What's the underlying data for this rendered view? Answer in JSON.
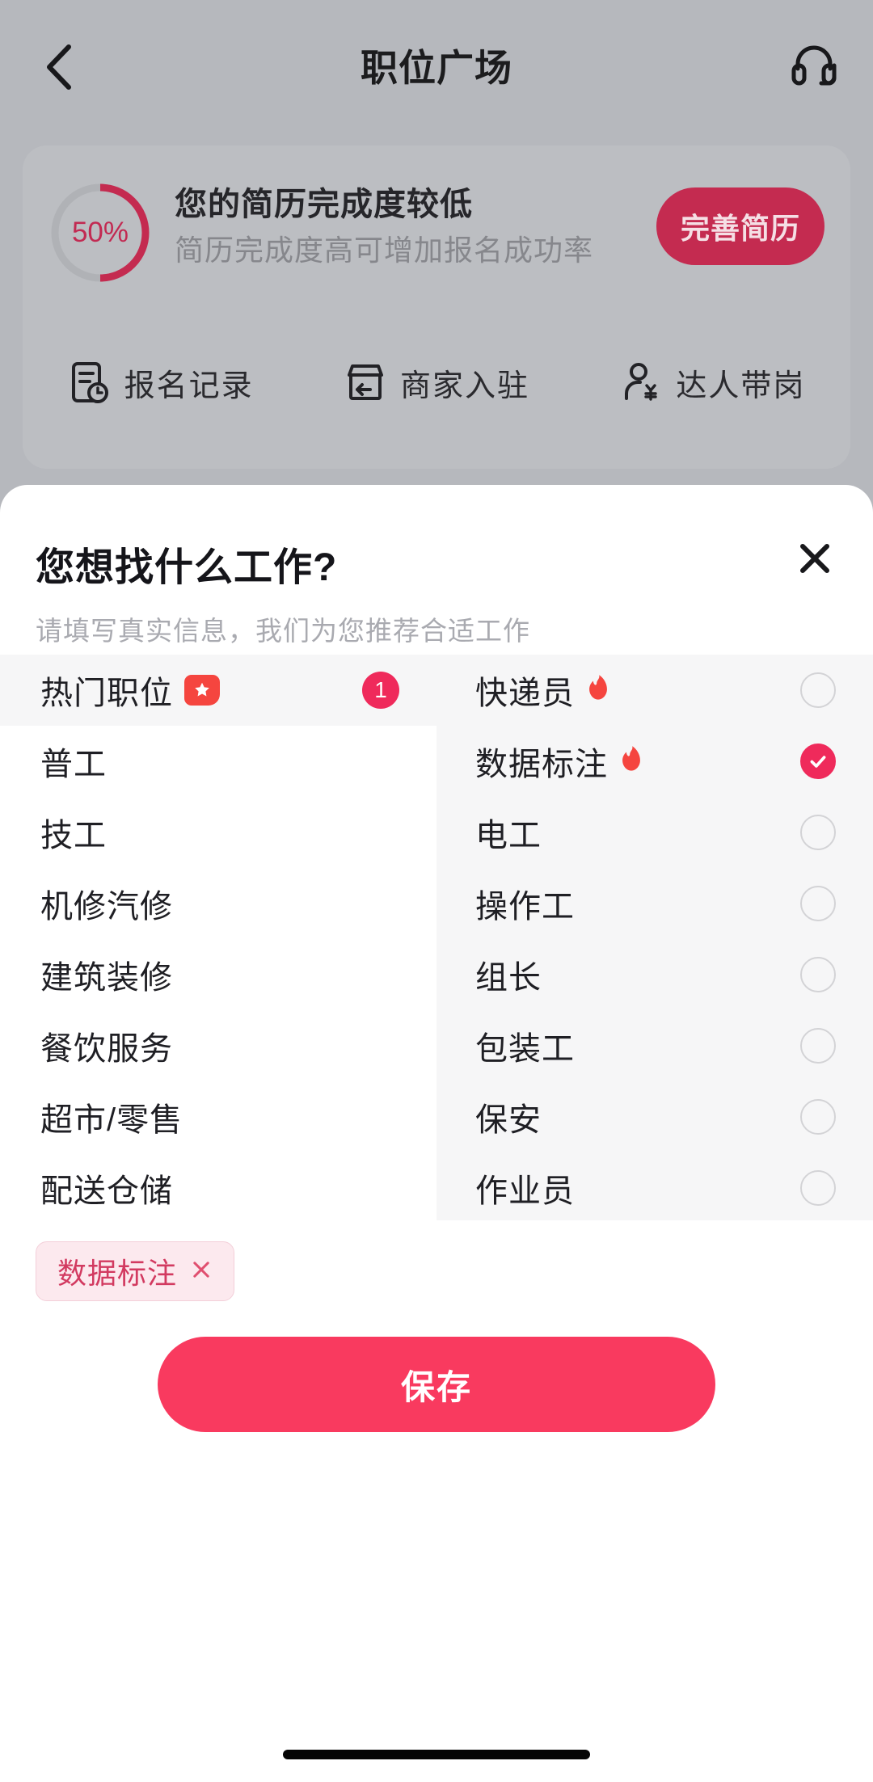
{
  "nav": {
    "back_icon": "chevron-left-icon",
    "title": "职位广场",
    "service_icon": "headset-icon"
  },
  "resume_card": {
    "progress_value": "50%",
    "progress_percent": 50,
    "title": "您的简历完成度较低",
    "subtitle": "简历完成度高可增加报名成功率",
    "button_label": "完善简历",
    "accent_color": "#c42b50",
    "shortcuts": [
      {
        "label": "报名记录",
        "icon": "document-clock-icon"
      },
      {
        "label": "商家入驻",
        "icon": "shop-enter-icon"
      },
      {
        "label": "达人带岗",
        "icon": "person-yuan-icon"
      }
    ]
  },
  "sheet": {
    "title": "您想找什么工作?",
    "subtitle": "请填写真实信息，我们为您推荐合适工作",
    "close_icon": "close-icon",
    "categories": [
      {
        "label": "热门职位",
        "active": true,
        "tag_icon": "star-tag-icon",
        "badge": "1"
      },
      {
        "label": "普工",
        "active": false
      },
      {
        "label": "技工",
        "active": false
      },
      {
        "label": "机修汽修",
        "active": false
      },
      {
        "label": "建筑装修",
        "active": false
      },
      {
        "label": "餐饮服务",
        "active": false
      },
      {
        "label": "超市/零售",
        "active": false
      },
      {
        "label": "配送仓储",
        "active": false
      }
    ],
    "jobs": [
      {
        "label": "快递员",
        "hot": true,
        "checked": false
      },
      {
        "label": "数据标注",
        "hot": true,
        "checked": true
      },
      {
        "label": "电工",
        "hot": false,
        "checked": false
      },
      {
        "label": "操作工",
        "hot": false,
        "checked": false
      },
      {
        "label": "组长",
        "hot": false,
        "checked": false
      },
      {
        "label": "包装工",
        "hot": false,
        "checked": false
      },
      {
        "label": "保安",
        "hot": false,
        "checked": false
      },
      {
        "label": "作业员",
        "hot": false,
        "checked": false
      }
    ],
    "selected_chips": [
      {
        "label": "数据标注",
        "remove_icon": "close-icon"
      }
    ],
    "save_label": "保存",
    "primary_color": "#f93a5f",
    "checked_color": "#ef2a5b"
  }
}
